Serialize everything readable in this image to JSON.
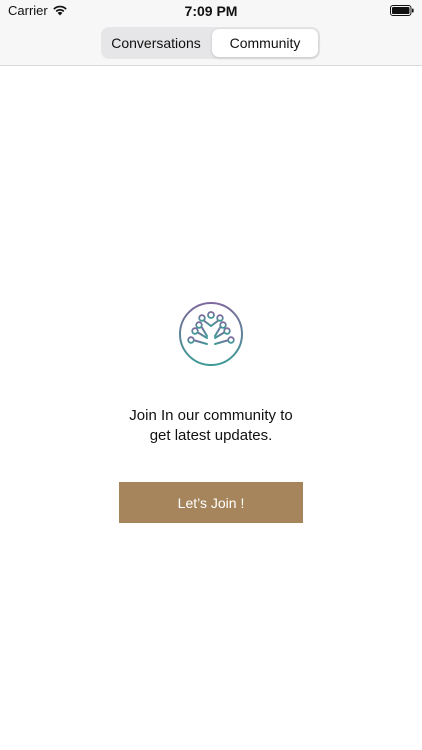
{
  "status_bar": {
    "carrier": "Carrier",
    "time": "7:09 PM",
    "wifi_icon": "wifi-icon",
    "battery_icon": "battery-icon"
  },
  "segmented_control": {
    "options": [
      {
        "label": "Conversations",
        "selected": false
      },
      {
        "label": "Community",
        "selected": true
      }
    ]
  },
  "main": {
    "logo_icon": "community-tree-logo",
    "message_line1": "Join In our community to",
    "message_line2": "get latest updates.",
    "join_button_label": "Let’s Join !"
  },
  "colors": {
    "button_bg": "#a6855c",
    "logo_gradient_top": "#7f6a9c",
    "logo_gradient_bottom": "#3e9b96",
    "nav_bg": "#f7f7f7"
  }
}
